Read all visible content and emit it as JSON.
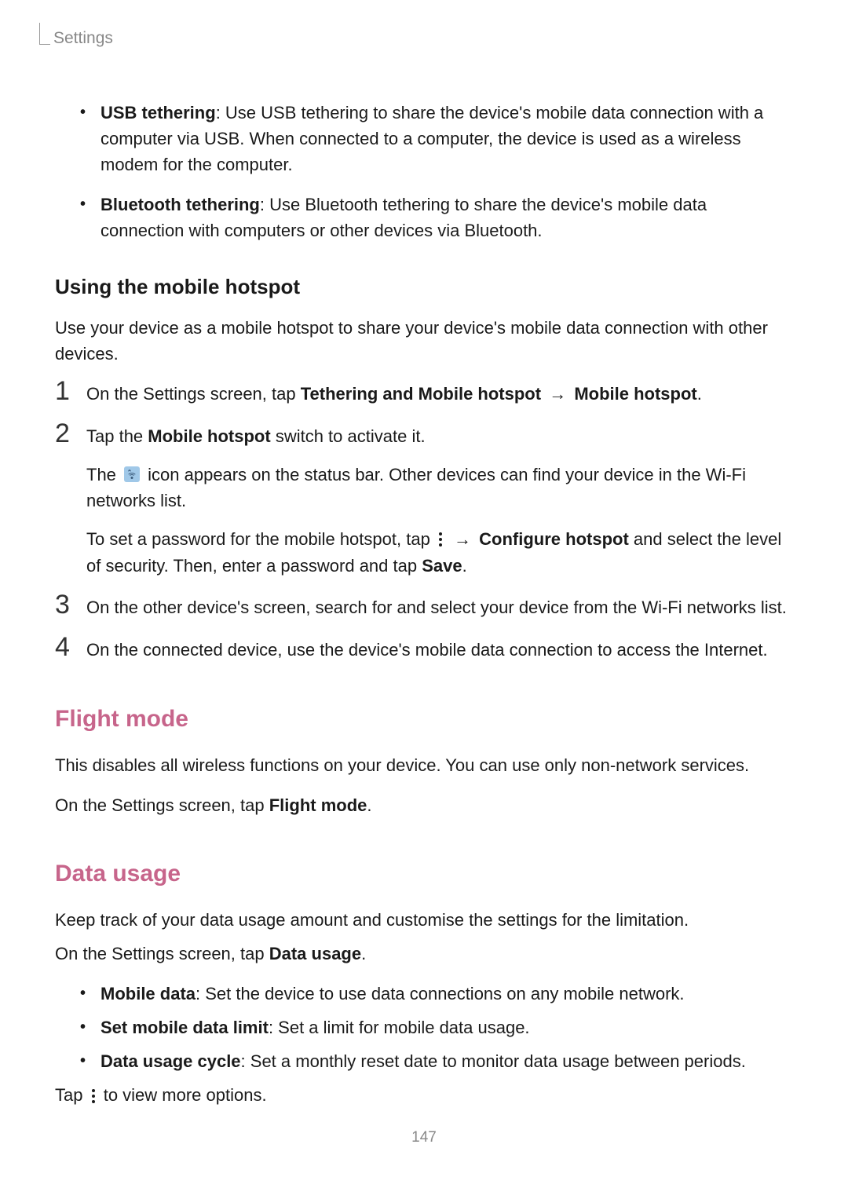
{
  "header": {
    "section": "Settings"
  },
  "tethering_list": [
    {
      "title": "USB tethering",
      "desc": ": Use USB tethering to share the device's mobile data connection with a computer via USB. When connected to a computer, the device is used as a wireless modem for the computer."
    },
    {
      "title": "Bluetooth tethering",
      "desc": ": Use Bluetooth tethering to share the device's mobile data connection with computers or other devices via Bluetooth."
    }
  ],
  "hotspot": {
    "heading": "Using the mobile hotspot",
    "intro": "Use your device as a mobile hotspot to share your device's mobile data connection with other devices.",
    "step1": {
      "pre": "On the Settings screen, tap ",
      "bold1": "Tethering and Mobile hotspot",
      "arrow": " → ",
      "bold2": "Mobile hotspot",
      "post": "."
    },
    "step2": {
      "line1_pre": "Tap the ",
      "line1_bold": "Mobile hotspot",
      "line1_post": " switch to activate it.",
      "line2_pre": "The ",
      "line2_post": " icon appears on the status bar. Other devices can find your device in the Wi-Fi networks list.",
      "line3_pre": "To set a password for the mobile hotspot, tap ",
      "line3_arrow": " → ",
      "line3_bold": "Configure hotspot",
      "line3_mid": " and select the level of security. Then, enter a password and tap ",
      "line3_bold2": "Save",
      "line3_post": "."
    },
    "step3": "On the other device's screen, search for and select your device from the Wi-Fi networks list.",
    "step4": "On the connected device, use the device's mobile data connection to access the Internet."
  },
  "flight_mode": {
    "heading": "Flight mode",
    "para1": "This disables all wireless functions on your device. You can use only non-network services.",
    "para2_pre": "On the Settings screen, tap ",
    "para2_bold": "Flight mode",
    "para2_post": "."
  },
  "data_usage": {
    "heading": "Data usage",
    "para1": "Keep track of your data usage amount and customise the settings for the limitation.",
    "para2_pre": "On the Settings screen, tap ",
    "para2_bold": "Data usage",
    "para2_post": ".",
    "bullets": [
      {
        "title": "Mobile data",
        "desc": ": Set the device to use data connections on any mobile network."
      },
      {
        "title": "Set mobile data limit",
        "desc": ": Set a limit for mobile data usage."
      },
      {
        "title": "Data usage cycle",
        "desc": ": Set a monthly reset date to monitor data usage between periods."
      }
    ],
    "more_pre": "Tap ",
    "more_post": " to view more options."
  },
  "page_number": "147"
}
